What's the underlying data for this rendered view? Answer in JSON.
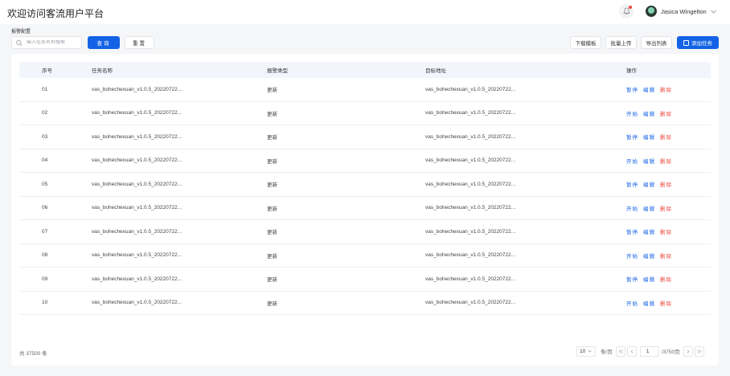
{
  "header": {
    "title": "欢迎访问客流用户平台",
    "user_name": "Jasica Wingelton"
  },
  "section_label": "报警配置",
  "toolbar": {
    "search_placeholder": "输入任务名称搜索",
    "query_label": "查询",
    "reset_label": "重置",
    "download_label": "下载模板",
    "upload_label": "批量上传",
    "export_label": "导出列表",
    "add_label": "添加任务"
  },
  "table": {
    "columns": [
      "序号",
      "任务名称",
      "报警类型",
      "目标地址",
      "操作"
    ],
    "rows": [
      {
        "idx": "01",
        "name": "vas_bohechexuan_v1.0.5_20220722...",
        "type": "更新",
        "target": "vas_bohechexuan_v1.0.5_20220722...",
        "toggle": "暂停",
        "edit": "编辑",
        "delete": "删除"
      },
      {
        "idx": "02",
        "name": "vas_bohechexuan_v1.0.5_20220722...",
        "type": "更新",
        "target": "vas_bohechexuan_v1.0.5_20220722...",
        "toggle": "开始",
        "edit": "编辑",
        "delete": "删除"
      },
      {
        "idx": "03",
        "name": "vas_bohechexuan_v1.0.5_20220722...",
        "type": "更新",
        "target": "vas_bohechexuan_v1.0.5_20220722...",
        "toggle": "暂停",
        "edit": "编辑",
        "delete": "删除"
      },
      {
        "idx": "04",
        "name": "vas_bohechexuan_v1.0.5_20220722...",
        "type": "更新",
        "target": "vas_bohechexuan_v1.0.5_20220722...",
        "toggle": "开始",
        "edit": "编辑",
        "delete": "删除"
      },
      {
        "idx": "05",
        "name": "vas_bohechexuan_v1.0.5_20220722...",
        "type": "更新",
        "target": "vas_bohechexuan_v1.0.5_20220722...",
        "toggle": "暂停",
        "edit": "编辑",
        "delete": "删除"
      },
      {
        "idx": "06",
        "name": "vas_bohechexuan_v1.0.5_20220722...",
        "type": "更新",
        "target": "vas_bohechexuan_v1.0.5_20220722...",
        "toggle": "开始",
        "edit": "编辑",
        "delete": "删除"
      },
      {
        "idx": "07",
        "name": "vas_bohechexuan_v1.0.5_20220722...",
        "type": "更新",
        "target": "vas_bohechexuan_v1.0.5_20220722...",
        "toggle": "暂停",
        "edit": "编辑",
        "delete": "删除"
      },
      {
        "idx": "08",
        "name": "vas_bohechexuan_v1.0.5_20220722...",
        "type": "更新",
        "target": "vas_bohechexuan_v1.0.5_20220722...",
        "toggle": "开始",
        "edit": "编辑",
        "delete": "删除"
      },
      {
        "idx": "09",
        "name": "vas_bohechexuan_v1.0.5_20220722...",
        "type": "更新",
        "target": "vas_bohechexuan_v1.0.5_20220722...",
        "toggle": "暂停",
        "edit": "编辑",
        "delete": "删除"
      },
      {
        "idx": "10",
        "name": "vas_bohechexuan_v1.0.5_20220722...",
        "type": "更新",
        "target": "vas_bohechexuan_v1.0.5_20220722...",
        "toggle": "开始",
        "edit": "编辑",
        "delete": "删除"
      }
    ]
  },
  "footer": {
    "total": "共 37500 条",
    "page_size": "10",
    "page_unit": "条/页",
    "current_page": "1",
    "total_pages": "/3750页"
  },
  "colors": {
    "primary": "#1463e6",
    "danger": "#f0483e",
    "header_bg": "#f2f6fc"
  }
}
